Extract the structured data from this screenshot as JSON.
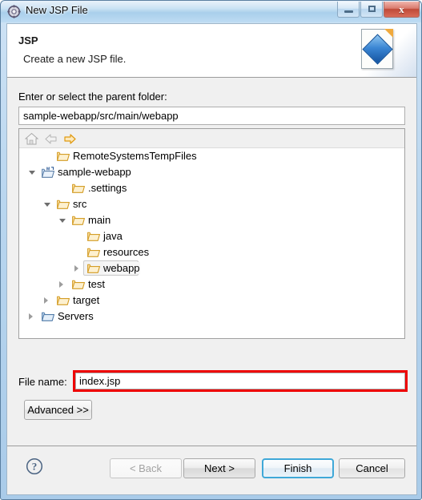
{
  "window": {
    "title": "New JSP File",
    "icon": "gear-icon",
    "controls": {
      "minimize": "minimize-button",
      "maximize": "maximize-button",
      "close_label": "x"
    }
  },
  "wizard_header": {
    "title": "JSP",
    "description": "Create a new JSP file.",
    "banner_icon": "jsp-document-icon"
  },
  "parent_folder": {
    "label": "Enter or select the parent folder:",
    "value": "sample-webapp/src/main/webapp",
    "placeholder": ""
  },
  "tree_toolbar": {
    "home_icon": "home-icon",
    "back_icon": "back-arrow-icon",
    "forward_icon": "forward-arrow-icon"
  },
  "tree": {
    "nodes": [
      {
        "label": "RemoteSystemsTempFiles",
        "depth": 1,
        "twisty": "none",
        "icon": "folder-icon",
        "selected": false
      },
      {
        "label": "sample-webapp",
        "depth": 0,
        "twisty": "open",
        "icon": "maven-project-icon",
        "selected": false
      },
      {
        "label": ".settings",
        "depth": 2,
        "twisty": "none",
        "icon": "folder-icon",
        "selected": false
      },
      {
        "label": "src",
        "depth": 1,
        "twisty": "open",
        "icon": "folder-icon",
        "selected": false
      },
      {
        "label": "main",
        "depth": 2,
        "twisty": "open",
        "icon": "folder-icon",
        "selected": false
      },
      {
        "label": "java",
        "depth": 3,
        "twisty": "none",
        "icon": "folder-icon",
        "selected": false
      },
      {
        "label": "resources",
        "depth": 3,
        "twisty": "none",
        "icon": "folder-icon",
        "selected": false
      },
      {
        "label": "webapp",
        "depth": 3,
        "twisty": "closed",
        "icon": "folder-icon",
        "selected": true
      },
      {
        "label": "test",
        "depth": 2,
        "twisty": "closed",
        "icon": "folder-icon",
        "selected": false
      },
      {
        "label": "target",
        "depth": 1,
        "twisty": "closed",
        "icon": "folder-icon",
        "selected": false
      },
      {
        "label": "Servers",
        "depth": 0,
        "twisty": "closed",
        "icon": "servers-folder-icon",
        "selected": false
      }
    ]
  },
  "file_name": {
    "label": "File name:",
    "value": "index.jsp",
    "placeholder": "",
    "highlighted": true
  },
  "advanced": {
    "label": "Advanced >>"
  },
  "footer": {
    "help_icon": "help-question-icon",
    "buttons": {
      "back": "< Back",
      "next": "Next >",
      "finish": "Finish",
      "cancel": "Cancel"
    }
  },
  "colors": {
    "annotation_red": "#ee0000",
    "default_button_blue": "#3fa8d8",
    "dialog_background": "#f0f0f0",
    "folder_orange": "#f0b94a"
  }
}
